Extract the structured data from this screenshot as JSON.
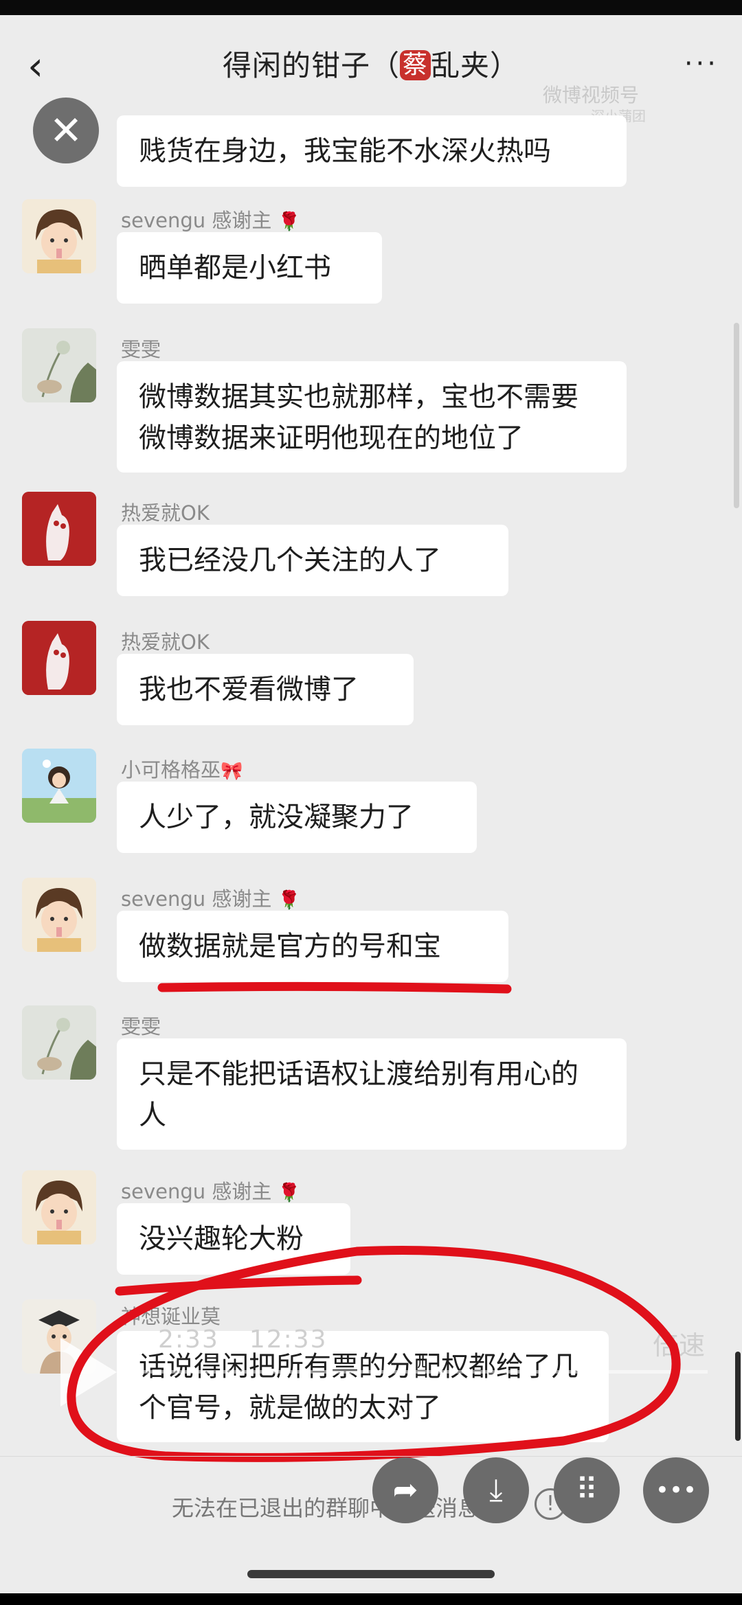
{
  "header": {
    "title_prefix": "得闲的钳子（",
    "title_tag": "蔡",
    "title_suffix": "乱夹）",
    "back_icon": "‹",
    "more_icon": "···"
  },
  "watermark": {
    "line1": "微博视频号",
    "line2": "深小蒲团"
  },
  "messages": [
    {
      "id": "m0",
      "sender": "",
      "text": "贱货在身边，我宝能不水深火热吗"
    },
    {
      "id": "m1",
      "sender": "sevengu 感谢主",
      "emoji": "🌹",
      "text": "晒单都是小红书"
    },
    {
      "id": "m2",
      "sender": "雯雯",
      "emoji": "",
      "text": "微博数据其实也就那样，宝也不需要微博数据来证明他现在的地位了"
    },
    {
      "id": "m3",
      "sender": "热爱就OK",
      "emoji": "",
      "text": "我已经没几个关注的人了"
    },
    {
      "id": "m4",
      "sender": "热爱就OK",
      "emoji": "",
      "text": "我也不爱看微博了"
    },
    {
      "id": "m5",
      "sender": "小可格格巫",
      "emoji": "🎀",
      "text": "人少了，就没凝聚力了"
    },
    {
      "id": "m6",
      "sender": "sevengu 感谢主",
      "emoji": "🌹",
      "text": "做数据就是官方的号和宝"
    },
    {
      "id": "m7",
      "sender": "雯雯",
      "emoji": "",
      "text": "只是不能把话语权让渡给别有用心的人"
    },
    {
      "id": "m8",
      "sender": "sevengu 感谢主",
      "emoji": "🌹",
      "text": "没兴趣轮大粉"
    },
    {
      "id": "m9",
      "sender": "神想诞业莫",
      "emoji": "",
      "text": "话说得闲把所有票的分配权都给了几个官号，就是做的太对了"
    }
  ],
  "video": {
    "current_time": "2:33",
    "duration": "12:33",
    "speed_label": "倍速",
    "progress": 0.2
  },
  "footer": {
    "notice": "无法在已退出的群聊中发送消息",
    "info_icon": "!"
  },
  "actions": {
    "share_icon": "➦",
    "download_icon": "⤓",
    "grid_icon": "⠿",
    "more_icon": "•••"
  },
  "colors": {
    "annotation_red": "#e0101a",
    "background": "#ececec"
  }
}
